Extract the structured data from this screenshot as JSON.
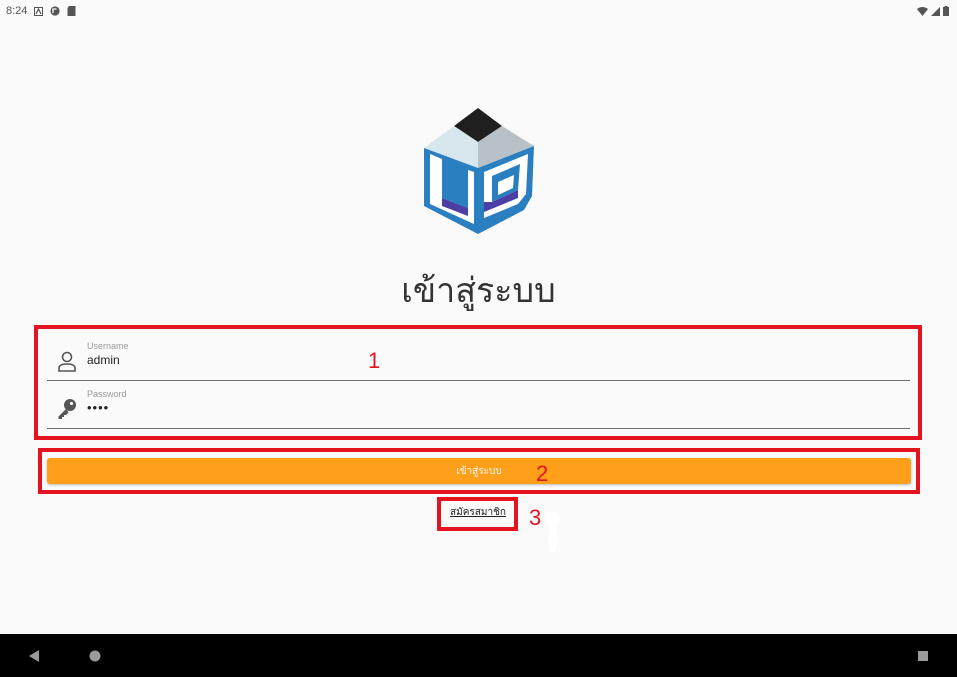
{
  "status_bar": {
    "time": "8:24",
    "left_icons": [
      "notification-a-icon",
      "app-notification-icon",
      "sd-card-icon"
    ],
    "right_icons": [
      "wifi-icon",
      "signal-icon",
      "battery-icon"
    ]
  },
  "logo": {
    "name": "app-logo"
  },
  "page": {
    "title": "เข้าสู่ระบบ"
  },
  "form": {
    "username": {
      "label": "Username",
      "value": "admin",
      "icon": "person-icon"
    },
    "password": {
      "label": "Password",
      "value": "••••",
      "icon": "key-icon"
    },
    "login_button": "เข้าสู่ระบบ",
    "register_link": "สมัครสมาชิก"
  },
  "annotations": [
    "1",
    "2",
    "3"
  ],
  "colors": {
    "accent": "#ff9f1a",
    "annotation": "#e3141f",
    "background": "#fafafa",
    "logo_blue": "#2a7fc1",
    "logo_purple": "#4b3fa6"
  },
  "nav_bar": {
    "buttons": [
      "back-icon",
      "home-icon",
      "recents-icon"
    ]
  }
}
